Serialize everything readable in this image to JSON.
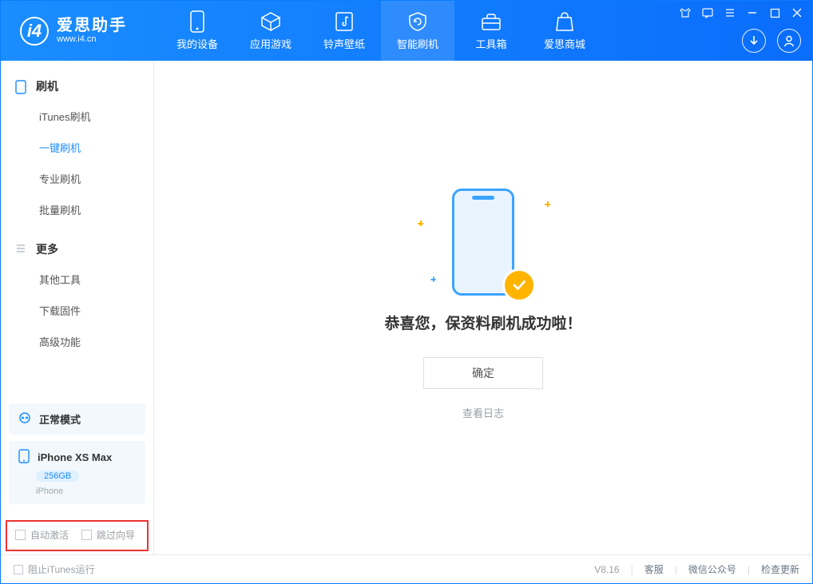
{
  "logo": {
    "cn": "爱思助手",
    "en": "www.i4.cn"
  },
  "nav": {
    "device": "我的设备",
    "apps": "应用游戏",
    "ring": "铃声壁纸",
    "flash": "智能刷机",
    "tools": "工具箱",
    "store": "爱思商城"
  },
  "sidebar": {
    "group1_title": "刷机",
    "g1": {
      "itunes": "iTunes刷机",
      "onekey": "一键刷机",
      "pro": "专业刷机",
      "batch": "批量刷机"
    },
    "group2_title": "更多",
    "g2": {
      "other": "其他工具",
      "firmware": "下载固件",
      "adv": "高级功能"
    }
  },
  "mode": {
    "normal": "正常模式"
  },
  "device": {
    "name": "iPhone XS Max",
    "storage": "256GB",
    "type": "iPhone"
  },
  "checks": {
    "auto_activate": "自动激活",
    "skip_guide": "跳过向导"
  },
  "main": {
    "success": "恭喜您，保资料刷机成功啦！",
    "ok": "确定",
    "log": "查看日志"
  },
  "footer": {
    "block_itunes": "阻止iTunes运行",
    "version": "V8.16",
    "support": "客服",
    "wechat": "微信公众号",
    "update": "检查更新"
  }
}
